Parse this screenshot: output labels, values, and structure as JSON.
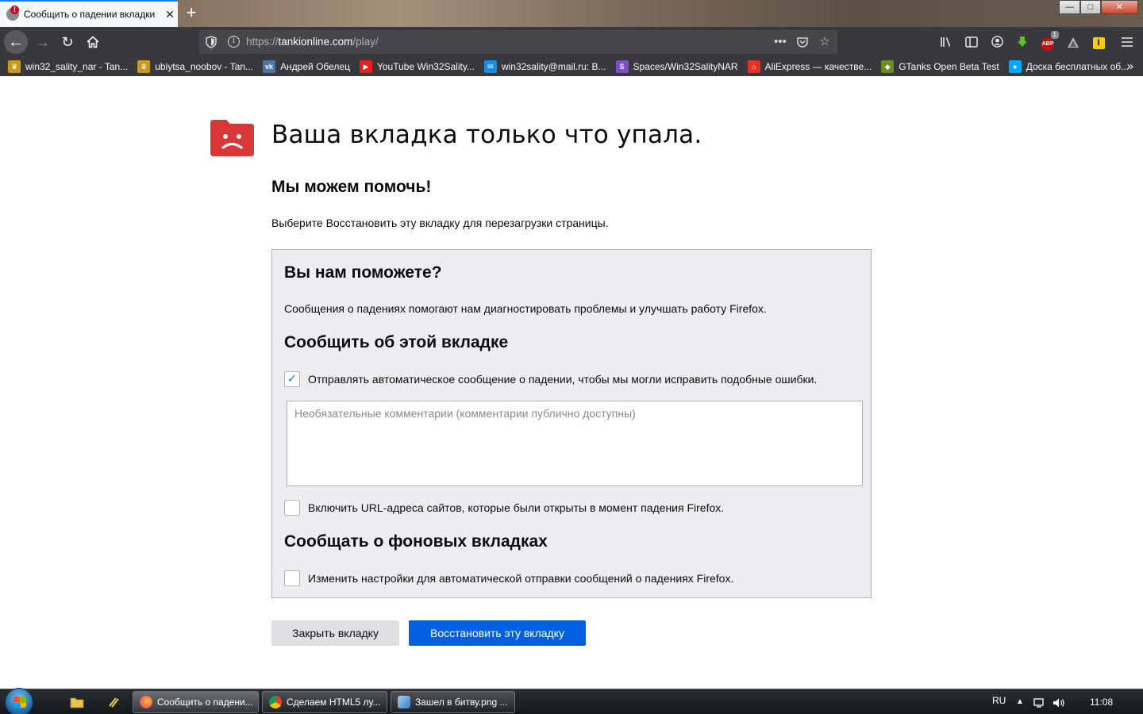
{
  "browser": {
    "tab": {
      "title": "Сообщить о падении вкладки",
      "error_badge": "!",
      "close_glyph": "✕"
    },
    "new_tab_glyph": "+",
    "window_controls": {
      "minimize": "—",
      "maximize": "□",
      "close": "✕"
    },
    "nav": {
      "back_icon": "arrow-left-icon",
      "forward_icon": "arrow-right-icon",
      "reload_icon": "reload-icon",
      "home_icon": "home-icon"
    },
    "url": {
      "prefix": "https://",
      "host": "tankionline.com",
      "path": "/play/"
    },
    "toolbar_badge": "1",
    "abp_label": "ABP",
    "yellow_ext_label": "I"
  },
  "bookmarks": [
    {
      "label": "win32_sality_nar - Tan...",
      "icon": "tank-crown-icon",
      "color": "#c99a1a"
    },
    {
      "label": "ubiytsa_noobov - Tan...",
      "icon": "tank-crown-icon",
      "color": "#c99a1a"
    },
    {
      "label": "Андрей Обелец",
      "icon": "vk-icon",
      "color": "#4a76a8"
    },
    {
      "label": "YouTube Win32Sality...",
      "icon": "youtube-icon",
      "color": "#e62117"
    },
    {
      "label": "win32sality@mail.ru: В...",
      "icon": "mail-icon",
      "color": "#168de2"
    },
    {
      "label": "Spaces/Win32SalityNAR",
      "icon": "spaces-icon",
      "color": "#7a4fc4"
    },
    {
      "label": "AliExpress — качестве...",
      "icon": "cart-icon",
      "color": "#e43225"
    },
    {
      "label": "GTanks Open Beta Test",
      "icon": "gtanks-icon",
      "color": "#6b8e23"
    },
    {
      "label": "Доска бесплатных об...",
      "icon": "avito-icon",
      "color": "#00aaff"
    }
  ],
  "page": {
    "headline": "Ваша вкладка только что упала.",
    "subhead": "Мы можем помочь!",
    "hint": "Выберите Восстановить эту вкладку для перезагрузки страницы.",
    "panel": {
      "title": "Вы нам поможете?",
      "description": "Сообщения о падениях помогают нам диагностировать проблемы и улучшать работу Firefox.",
      "report_heading": "Сообщить об этой вкладке",
      "auto_report_label": "Отправлять автоматическое сообщение о падении, чтобы мы могли исправить подобные ошибки.",
      "auto_report_checked": true,
      "comments_placeholder": "Необязательные комментарии (комментарии публично доступны)",
      "include_urls_label": "Включить URL-адреса сайтов, которые были открыты в момент падения Firefox.",
      "include_urls_checked": false,
      "background_heading": "Сообщать о фоновых вкладках",
      "change_settings_label": "Изменить настройки для автоматической отправки сообщений о падениях Firefox.",
      "change_settings_checked": false
    },
    "close_button": "Закрыть вкладку",
    "restore_button": "Восстановить эту вкладку",
    "crash_icon_color": "#d93737",
    "primary_color": "#0060df"
  },
  "taskbar": {
    "tasks": [
      {
        "label": "Сообщить о падени...",
        "icon": "firefox-icon"
      },
      {
        "label": "Сделаем HTML5 лу...",
        "icon": "chrome-icon"
      },
      {
        "label": "Зашел в битву.png ...",
        "icon": "image-viewer-icon"
      }
    ],
    "language": "RU",
    "clock": "11:08"
  }
}
